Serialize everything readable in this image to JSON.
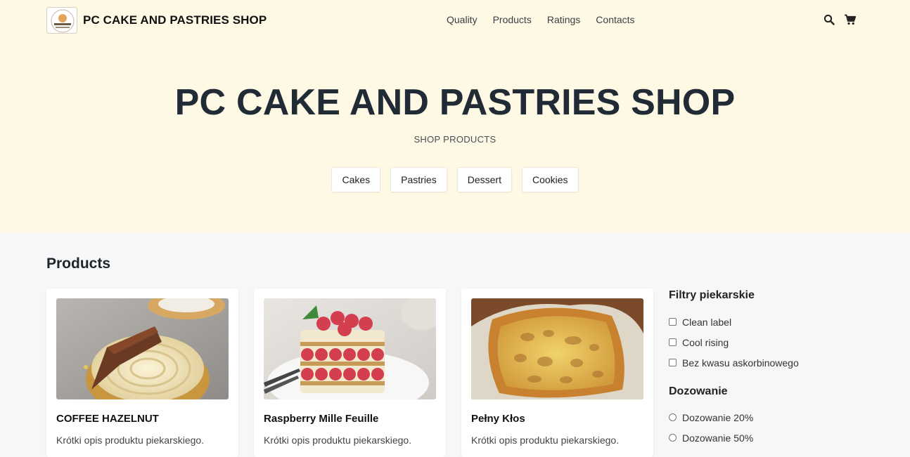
{
  "header": {
    "brand": "PC CAKE AND PASTRIES SHOP",
    "nav": [
      "Quality",
      "Products",
      "Ratings",
      "Contacts"
    ],
    "icons": [
      "search-icon",
      "cart-icon"
    ]
  },
  "hero": {
    "title": "PC CAKE AND PASTRIES SHOP",
    "subtitle": "SHOP PRODUCTS",
    "categories": [
      "Cakes",
      "Pastries",
      "Dessert",
      "Cookies"
    ]
  },
  "products": {
    "title": "Products",
    "items": [
      {
        "name": "COFFEE HAZELNUT",
        "desc": "Krótki opis produktu piekarskiego."
      },
      {
        "name": "Raspberry Mille Feuille",
        "desc": "Krótki opis produktu piekarskiego."
      },
      {
        "name": "Pełny Kłos",
        "desc": "Krótki opis produktu piekarskiego."
      }
    ]
  },
  "filters": {
    "title": "Filtry piekarskie",
    "checkboxes": [
      "Clean label",
      "Cool rising",
      "Bez kwasu askorbinowego"
    ],
    "dosing_title": "Dozowanie",
    "radios": [
      "Dozowanie 20%",
      "Dozowanie 50%"
    ]
  },
  "colors": {
    "header_bg": "#fef9e4",
    "page_bg": "#f6f7f9",
    "title": "#212b36"
  }
}
